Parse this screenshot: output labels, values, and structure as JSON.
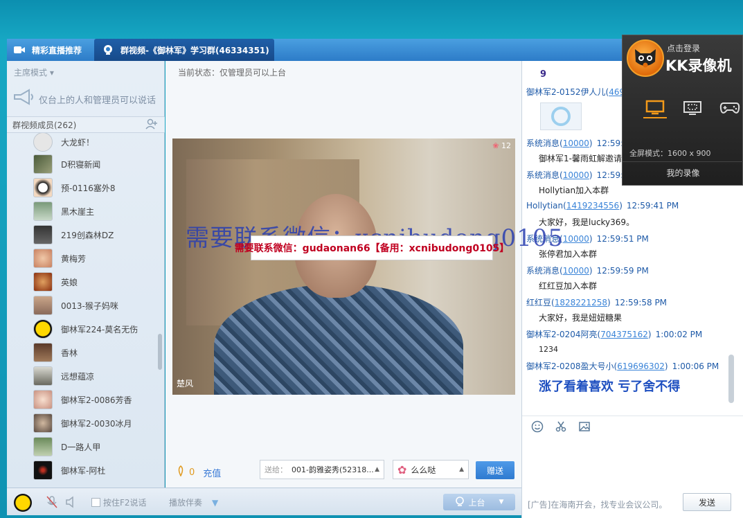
{
  "tabs": [
    {
      "label": "精彩直播推荐"
    },
    {
      "label": "群视频-《御林军》学习群(46334351)"
    }
  ],
  "left": {
    "mode_label": "主席模式",
    "notice": "仅台上的人和管理员可以说话",
    "members_header": "群视频成员(262)",
    "members": [
      {
        "name": "大龙虾！"
      },
      {
        "name": "D积寝新闻"
      },
      {
        "name": "预-0116塞外8"
      },
      {
        "name": "黑木崖主"
      },
      {
        "name": "219创森林DZ"
      },
      {
        "name": "黄梅芳"
      },
      {
        "name": "英娘"
      },
      {
        "name": "0013-猴子妈咪"
      },
      {
        "name": "御林军224-莫名无伤"
      },
      {
        "name": "香林"
      },
      {
        "name": "远想蕴凉"
      },
      {
        "name": "御林军2-0086芳香"
      },
      {
        "name": "御林军2-0030冰月"
      },
      {
        "name": "D一路人甲"
      },
      {
        "name": "御林军-阿杜"
      }
    ]
  },
  "bottom_bar": {
    "push_f2": "按住F2说话",
    "accompany": "播放伴奏",
    "go_stage": "上台"
  },
  "center": {
    "status": "当前状态：仅管理员可以上台",
    "camera_count": "12",
    "camera_name": "楚风",
    "watermark_big": "需要联系微信：xcnibudong0105",
    "watermark_box": "需要联系微信：gudaonan66【备用：xcnibudong0105】",
    "flower_count": "0",
    "charge": "充值",
    "send_to_label": "送给：",
    "send_to_value": "001-韵雅姿秀(52318...",
    "gift_name": "么么哒",
    "give_button": "赠送"
  },
  "chat": {
    "top_number": "9",
    "messages": [
      {
        "sender": "御林军2-0152伊人儿(",
        "qq": "469",
        "time": "",
        "text": ""
      },
      {
        "sender": "系统消息(",
        "qq": "10000",
        "time": "12:59:3",
        "text": "御林军1-馨雨虹解邀请"
      },
      {
        "sender": "系统消息(",
        "qq": "10000",
        "time": "12:59:4",
        "text": "Hollytian加入本群"
      },
      {
        "sender": "Hollytian(",
        "qq": "1419234556",
        "time": "12:59:41 PM",
        "text": "大家好，我是lucky369。"
      },
      {
        "sender": "系统消息(",
        "qq": "10000",
        "time": "12:59:51 PM",
        "text": "张停君加入本群"
      },
      {
        "sender": "系统消息(",
        "qq": "10000",
        "time": "12:59:59 PM",
        "text": "红红豆加入本群"
      },
      {
        "sender": "红红豆(",
        "qq": "1828221258",
        "time": "12:59:58 PM",
        "text": "大家好，我是妞妞糖果"
      },
      {
        "sender": "御林军2-0204阿亮(",
        "qq": "704375162",
        "time": "1:00:02 PM",
        "text": "1234"
      },
      {
        "sender": "御林军2-0208盈大号小(",
        "qq": "619696302",
        "time": "1:00:06 PM",
        "text": ""
      }
    ],
    "big_message": "涨了看着喜欢  亏了舍不得",
    "ad": "[广告]在海南开会，找专业会议公司。",
    "send_button": "发送"
  },
  "kk": {
    "login": "点击登录",
    "title": "KK录像机",
    "mode": "全屏模式：1600 x 900",
    "my_video": "我的录像"
  },
  "colors": {
    "accent_blue": "#2d7cc8",
    "send_button_blue": "#2f7ad0",
    "kk_orange": "#f39a1a"
  }
}
